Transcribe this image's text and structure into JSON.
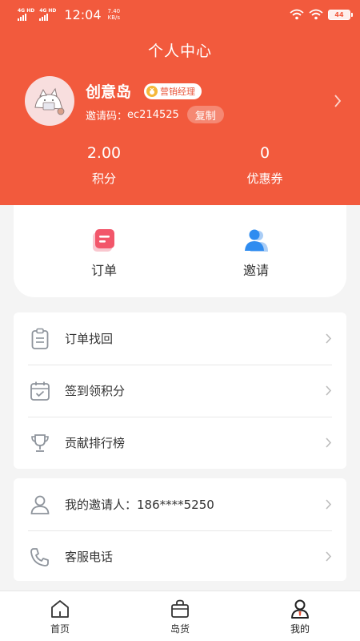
{
  "status_bar": {
    "network_1": "4G HD",
    "network_2": "4G HD",
    "time": "12:04",
    "speed_value": "7.40",
    "speed_unit": "KB/s",
    "battery": "44"
  },
  "page_title": "个人中心",
  "profile": {
    "name": "创意岛",
    "role": "营销经理",
    "invite_label": "邀请码：",
    "invite_code": "ec214525",
    "copy_label": "复制"
  },
  "stats": {
    "points_value": "2.00",
    "points_label": "积分",
    "coupons_value": "0",
    "coupons_label": "优惠券"
  },
  "quick_actions": {
    "orders_label": "订单",
    "invite_label": "邀请"
  },
  "menu_group_1": [
    {
      "label": "订单找回",
      "icon": "clipboard-icon"
    },
    {
      "label": "签到领积分",
      "icon": "calendar-check-icon"
    },
    {
      "label": "贡献排行榜",
      "icon": "trophy-icon"
    }
  ],
  "menu_group_2": [
    {
      "label": "我的邀请人：186****5250",
      "icon": "user-icon"
    },
    {
      "label": "客服电话",
      "icon": "phone-icon"
    }
  ],
  "tabbar": [
    {
      "label": "首页",
      "icon": "home-icon"
    },
    {
      "label": "岛货",
      "icon": "shopping-bag-icon"
    },
    {
      "label": "我的",
      "icon": "profile-icon",
      "active": true
    }
  ],
  "colors": {
    "brand": "#f25a3d",
    "order_icon": "#f2566a",
    "invite_icon": "#2f8cf0"
  }
}
